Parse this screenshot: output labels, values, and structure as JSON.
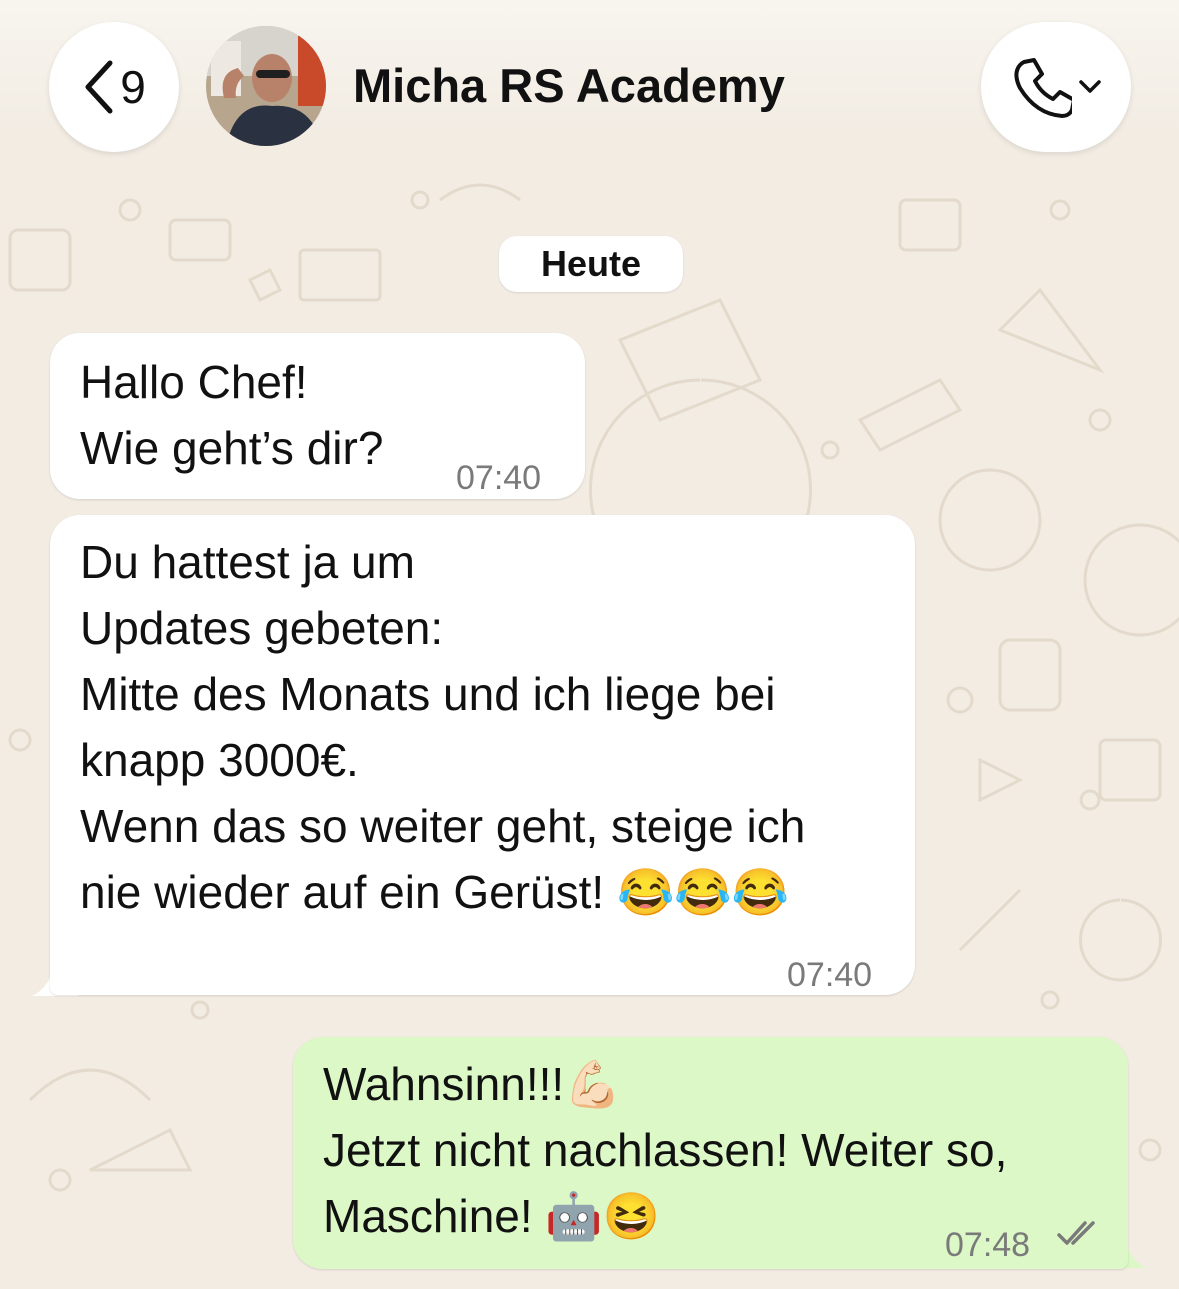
{
  "header": {
    "back_count": "9",
    "contact_name": "Micha RS Academy",
    "avatar_alt": "contact-avatar",
    "call_icon": "phone-icon"
  },
  "date_separator": "Heute",
  "messages": [
    {
      "direction": "incoming",
      "lines": [
        "Hallo Chef!",
        "Wie geht’s dir?"
      ],
      "time": "07:40"
    },
    {
      "direction": "incoming",
      "lines": [
        "Du hattest ja um",
        "Updates gebeten:",
        "Mitte des Monats und ich liege bei",
        "knapp 3000€.",
        "Wenn das so weiter geht, steige ich",
        "nie wieder auf ein Gerüst! 😂😂😂"
      ],
      "time": "07:40"
    },
    {
      "direction": "outgoing",
      "lines": [
        "Wahnsinn!!!💪🏻",
        "Jetzt nicht nachlassen! Weiter so,",
        "Maschine! 🤖😆"
      ],
      "time": "07:48",
      "status": "read-double-check"
    }
  ],
  "colors": {
    "wallpaper": "#f2ece3",
    "incoming_bubble": "#ffffff",
    "outgoing_bubble": "#dcf8c6",
    "time_text": "#7a7a7a"
  }
}
